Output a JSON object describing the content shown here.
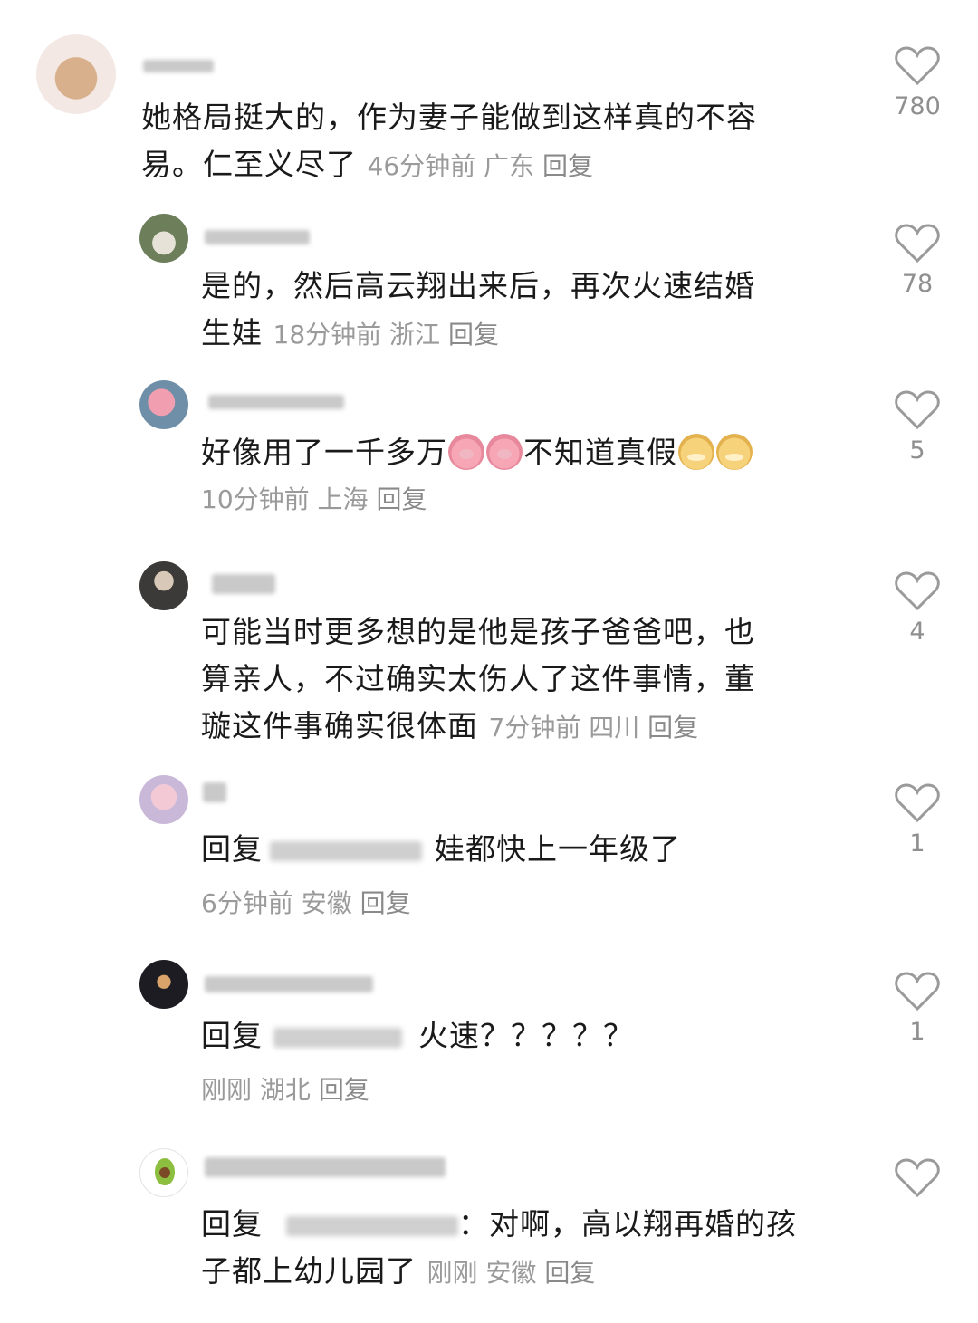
{
  "comments": [
    {
      "text": "她格局挺大的，作为妻子能做到这样真的不容易。仁至义尽了",
      "text_l1": "她格局挺大的，作为妻子能做到这样真的不容",
      "text_l2": "易。仁至义尽了",
      "time": "46分钟前",
      "location": "广东",
      "reply": "回复",
      "likes": "780",
      "avatar_icon": "bear-avatar-icon"
    },
    {
      "text_l1": "是的，然后高云翔出来后，再次火速结婚",
      "text_l2": "生娃",
      "time": "18分钟前",
      "location": "浙江",
      "reply": "回复",
      "likes": "78",
      "avatar_icon": "dogs-avatar-icon"
    },
    {
      "text_a": "好像用了一千多万",
      "text_b": "不知道真假",
      "time": "10分钟前",
      "location": "上海",
      "reply": "回复",
      "likes": "5",
      "avatar_icon": "pig-avatar-icon",
      "emoji_1": "pig-emoji",
      "emoji_2": "duck-emoji"
    },
    {
      "text_l1": "可能当时更多想的是他是孩子爸爸吧，也",
      "text_l2": "算亲人，不过确实太伤人了这件事情，董",
      "text_l3": "璇这件事确实很体面",
      "time": "7分钟前",
      "location": "四川",
      "reply": "回复",
      "likes": "4",
      "avatar_icon": "person-avatar-icon"
    },
    {
      "prefix": "回复",
      "text": "娃都快上一年级了",
      "time": "6分钟前",
      "location": "安徽",
      "reply": "回复",
      "likes": "1",
      "avatar_icon": "girl-avatar-icon"
    },
    {
      "prefix": "回复",
      "text": "火速？？？？？",
      "time": "刚刚",
      "location": "湖北",
      "reply": "回复",
      "likes": "1",
      "avatar_icon": "firework-avatar-icon"
    },
    {
      "prefix": "回复",
      "text_l1": "：对啊，高以翔再婚的孩",
      "text_l2": "子都上幼儿园了",
      "time": "刚刚",
      "location": "安徽",
      "reply": "回复",
      "likes": "",
      "avatar_icon": "avocado-avatar-icon"
    }
  ],
  "colors": {
    "text": "#1a1a1a",
    "meta": "#9a9a9a",
    "icon": "#9a9a9a"
  }
}
